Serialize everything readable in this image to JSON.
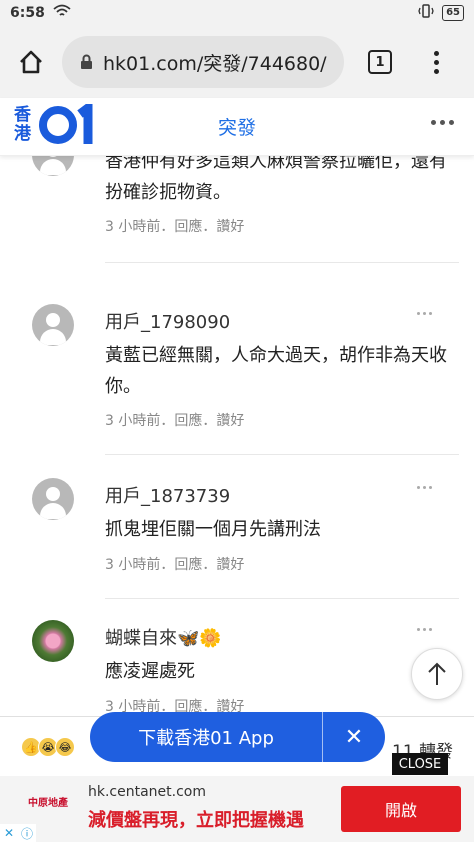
{
  "status_bar": {
    "time": "6:58",
    "battery": "65"
  },
  "browser": {
    "url": "hk01.com/突發/744680/",
    "tab_count": "1"
  },
  "site_header": {
    "logo_text": "香港",
    "section_title": "突發"
  },
  "comments": [
    {
      "username": "",
      "text": "香港仲有好多這類人麻煩警察拉曬佢，還有扮確診扼物資。",
      "meta": "3 小時前．回應．讚好"
    },
    {
      "username": "用戶_1798090",
      "text": "黃藍已經無關，人命大過天，胡作非為天收你。",
      "meta": "3 小時前．回應．讚好"
    },
    {
      "username": "用戶_1873739",
      "text": "抓鬼埋佢關一個月先講刑法",
      "meta": "3 小時前．回應．讚好"
    },
    {
      "username": "蝴蝶自來🦋🌼",
      "text": "應凌遲處死",
      "meta": "3 小時前．回應．讚好"
    }
  ],
  "action_bar": {
    "share_count": "11 轉發"
  },
  "download_banner": {
    "label": "下載香港01 App",
    "close": "✕"
  },
  "close_ad_label": "CLOSE",
  "ad": {
    "logo": "中原地產",
    "url": "hk.centanet.com",
    "headline": "減價盤再現，立即把握機遇",
    "cta": "開啟"
  },
  "colors": {
    "brand_blue": "#1f5fe0",
    "ad_red": "#e11d23"
  }
}
